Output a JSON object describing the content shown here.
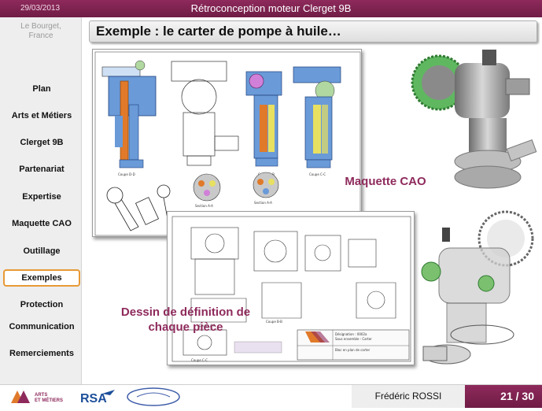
{
  "header": {
    "date": "29/03/2013",
    "title": "Rétroconception moteur Clerget 9B"
  },
  "sidebar": {
    "location": "Le Bourget,\nFrance",
    "items": [
      {
        "label": "Plan"
      },
      {
        "label": "Arts et Métiers"
      },
      {
        "label": "Clerget 9B"
      },
      {
        "label": "Partenariat"
      },
      {
        "label": "Expertise"
      },
      {
        "label": "Maquette CAO"
      },
      {
        "label": "Outillage"
      },
      {
        "label": "Exemples",
        "active": true
      },
      {
        "label": "Protection"
      },
      {
        "label": "Communication"
      },
      {
        "label": "Remerciements"
      }
    ]
  },
  "main": {
    "heading": "Exemple : le carter de pompe à huile…",
    "label_cao": "Maquette CAO",
    "label_dessin": "Dessin de définition de\nchaque pièce"
  },
  "footer": {
    "logos": [
      "ARTS ET MÉTIERS ParisTech",
      "RSA",
      "Ailes Anciennes Le Bourget"
    ],
    "author": "Frédéric ROSSI",
    "page": "21 / 30"
  },
  "colors": {
    "brand": "#7d2250",
    "accent": "#e79a36",
    "sidebar_bg": "#eeeeee"
  }
}
